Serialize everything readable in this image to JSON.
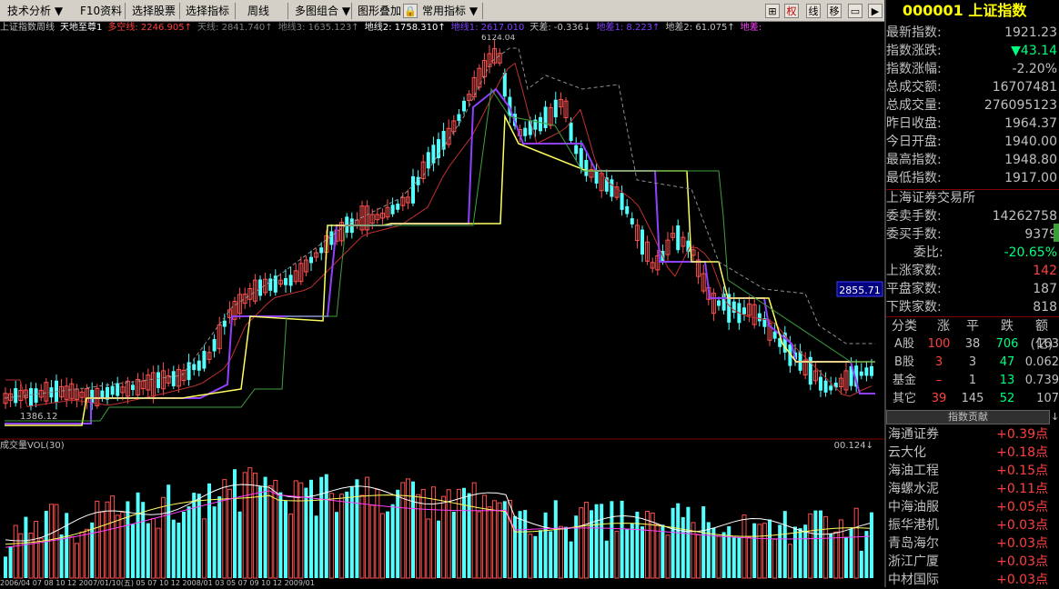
{
  "toolbar": {
    "items": [
      {
        "label": "技术分析"
      },
      {
        "label": "F10资料"
      },
      {
        "label": "选择股票"
      },
      {
        "label": "选择指标"
      },
      {
        "label": "周线"
      },
      {
        "label": "多图组合"
      },
      {
        "label": "图形叠加"
      },
      {
        "label": "常用指标"
      }
    ],
    "right_icons": [
      "⊞",
      "权",
      "线",
      "移",
      "▭",
      "▶"
    ]
  },
  "info_bar": {
    "name": "上证指数",
    "period": "周线",
    "indicator": "天地至尊1",
    "fields": [
      {
        "text": "多空线: 2246.905↑",
        "color": "#ff4040"
      },
      {
        "text": "天线: 2841.740↑",
        "color": "#808080"
      },
      {
        "text": "地线3: 1635.123↑",
        "color": "#808080"
      },
      {
        "text": "地线2: 1758.310↑",
        "color": "#ffffff"
      },
      {
        "text": "地线1: 2617.010",
        "color": "#8040ff"
      },
      {
        "text": "天差: -0.336↓",
        "color": "#c0c0c0"
      },
      {
        "text": "地差1: 8.223↑",
        "color": "#8040ff"
      },
      {
        "text": "地差2: 61.075↑",
        "color": "#c0c0c0"
      },
      {
        "text": "地差:",
        "color": "#ff40ff"
      }
    ]
  },
  "main_chart": {
    "price_tag": "2855.71",
    "low_label": "1386.12",
    "high_label": "6124.04"
  },
  "volume": {
    "header": "成交量VOL(30)",
    "right_value": "00.124↓"
  },
  "date_bar": "2006/04    07    08    10    12    2007/01/10(五)    05    07    10    12    2008/01    03    05    07    09    10    12    2009/01",
  "side": {
    "code": "000001",
    "name": "上证指数",
    "stats": [
      {
        "label": "最新指数:",
        "value": "1921.23",
        "color": "plain"
      },
      {
        "label": "指数涨跌:",
        "value": "▼43.14",
        "color": "green"
      },
      {
        "label": "指数涨幅:",
        "value": "-2.20%",
        "color": "plain"
      },
      {
        "label": "总成交额:",
        "value": "16707481",
        "color": "plain"
      },
      {
        "label": "总成交量:",
        "value": "276095123",
        "color": "plain"
      },
      {
        "label": "昨日收盘:",
        "value": "1964.37",
        "color": "plain"
      },
      {
        "label": "今日开盘:",
        "value": "1940.00",
        "color": "plain"
      },
      {
        "label": "最高指数:",
        "value": "1948.80",
        "color": "plain"
      },
      {
        "label": "最低指数:",
        "value": "1917.00",
        "color": "plain"
      }
    ],
    "exchange": "上海证券交易所",
    "exch_stats": [
      {
        "label": "委卖手数:",
        "value": "14262758",
        "color": "plain"
      },
      {
        "label": "委买手数:",
        "value": "9379",
        "color": "plain"
      },
      {
        "label": "委比:",
        "value": "-20.65%",
        "color": "green"
      },
      {
        "label": "上涨家数:",
        "value": "142",
        "color": "red"
      },
      {
        "label": "平盘家数:",
        "value": "187",
        "color": "plain"
      },
      {
        "label": "下跌家数:",
        "value": "818",
        "color": "plain"
      }
    ],
    "cat_headers": [
      "分类",
      "涨",
      "平",
      "跌",
      "额(亿)"
    ],
    "categories": [
      {
        "name": "A股",
        "up": "100",
        "flat": "38",
        "down": "706",
        "amt": "163"
      },
      {
        "name": "B股",
        "up": "3",
        "flat": "3",
        "down": "47",
        "amt": "0.062"
      },
      {
        "name": "基金",
        "up": "–",
        "flat": "1",
        "down": "13",
        "amt": "0.739"
      },
      {
        "name": "其它",
        "up": "39",
        "flat": "145",
        "down": "52",
        "amt": "107"
      }
    ],
    "contrib_button": "指数贡献",
    "contributors": [
      {
        "name": "海通证券",
        "value": "+0.39点"
      },
      {
        "name": "云大化",
        "value": "+0.18点"
      },
      {
        "name": "海油工程",
        "value": "+0.15点"
      },
      {
        "name": "海螺水泥",
        "value": "+0.11点"
      },
      {
        "name": "中海油服",
        "value": "+0.05点"
      },
      {
        "name": "振华港机",
        "value": "+0.03点"
      },
      {
        "name": "青岛海尔",
        "value": "+0.03点"
      },
      {
        "name": "浙江广厦",
        "value": "+0.03点"
      },
      {
        "name": "中材国际",
        "value": "+0.03点"
      }
    ]
  }
}
